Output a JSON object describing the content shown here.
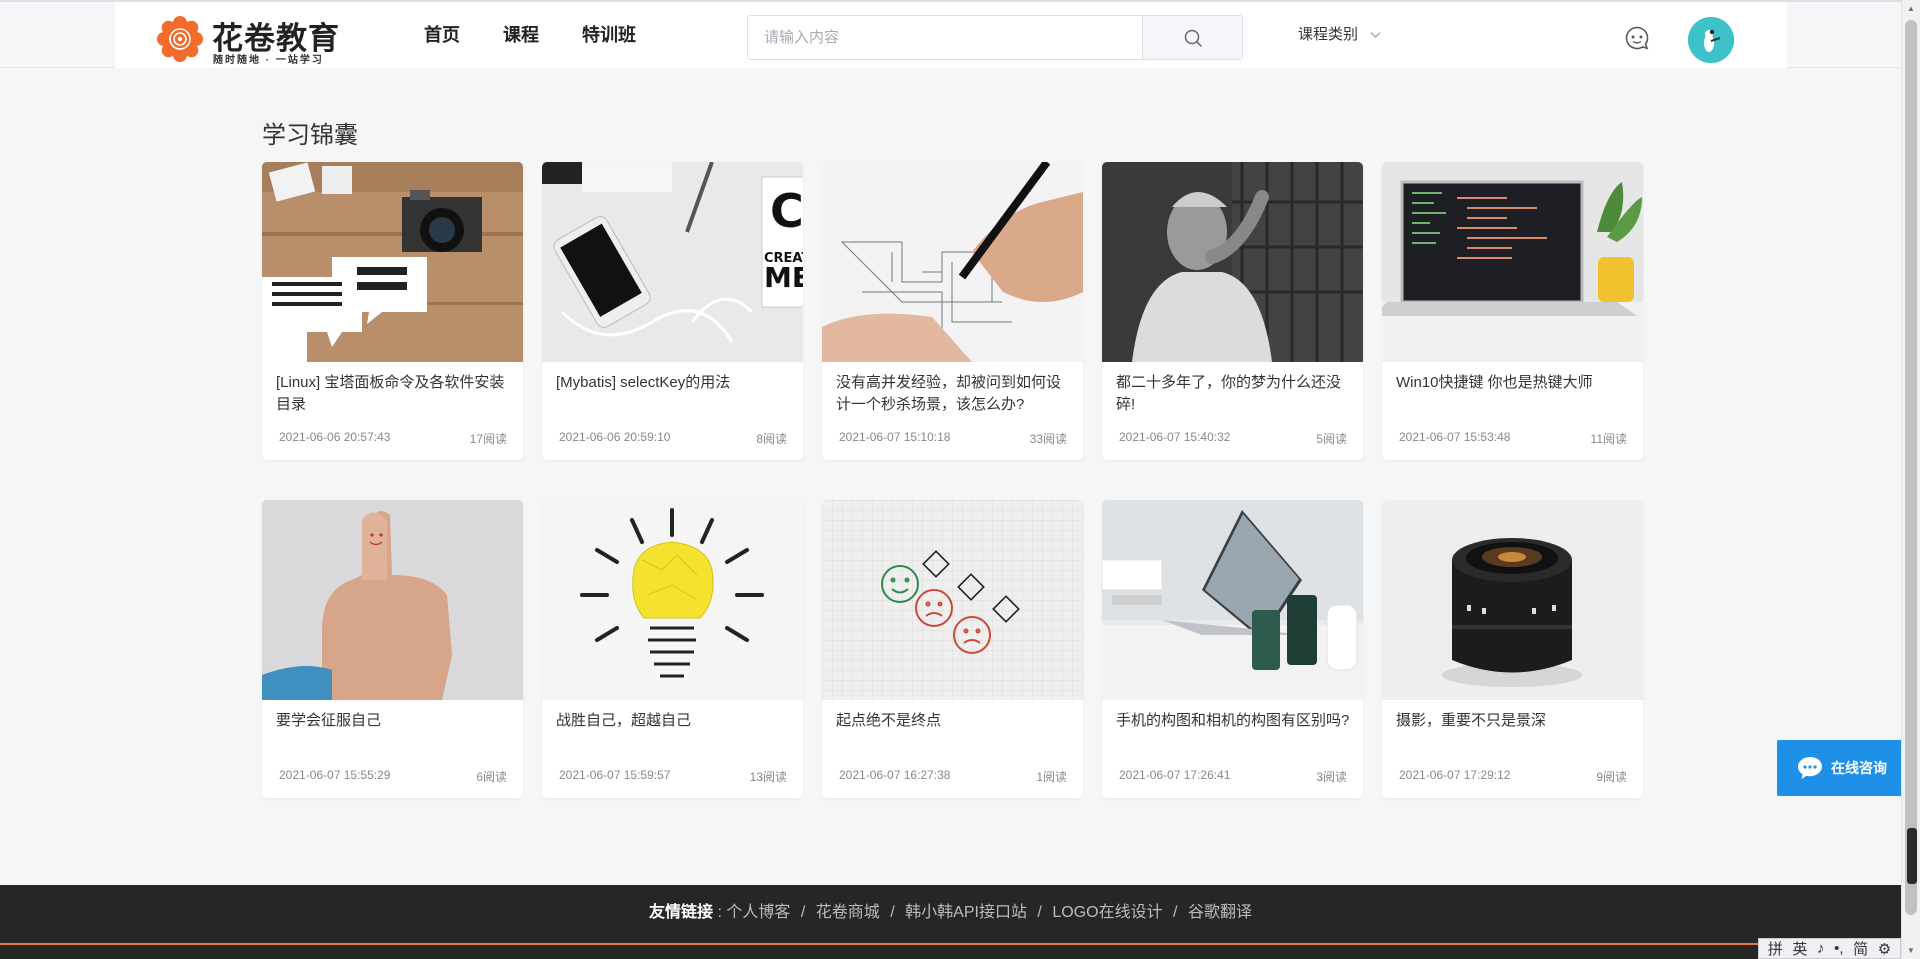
{
  "header": {
    "logo_title": "花卷教育",
    "logo_slogan": "随时随地 · 一站学习",
    "nav": [
      "首页",
      "课程",
      "特训班"
    ],
    "search_placeholder": "请输入内容",
    "category_label": "课程类别"
  },
  "main": {
    "section_title": "学习锦囊",
    "articles": [
      {
        "title": "[Linux] 宝塔面板命令及各软件安装目录",
        "date": "2021-06-06 20:57:43",
        "reads": "17阅读"
      },
      {
        "title": "[Mybatis] selectKey的用法",
        "date": "2021-06-06 20:59:10",
        "reads": "8阅读"
      },
      {
        "title": "没有高并发经验，却被问到如何设计一个秒杀场景，该怎么办?",
        "date": "2021-06-07 15:10:18",
        "reads": "33阅读"
      },
      {
        "title": "都二十多年了，你的梦为什么还没碎!",
        "date": "2021-06-07 15:40:32",
        "reads": "5阅读"
      },
      {
        "title": "Win10快捷键 你也是热键大师",
        "date": "2021-06-07 15:53:48",
        "reads": "11阅读"
      },
      {
        "title": "要学会征服自己",
        "date": "2021-06-07 15:55:29",
        "reads": "6阅读"
      },
      {
        "title": "战胜自己，超越自己",
        "date": "2021-06-07 15:59:57",
        "reads": "13阅读"
      },
      {
        "title": "起点绝不是终点",
        "date": "2021-06-07 16:27:38",
        "reads": "1阅读"
      },
      {
        "title": "手机的构图和相机的构图有区别吗?",
        "date": "2021-06-07 17:26:41",
        "reads": "3阅读"
      },
      {
        "title": "摄影，重要不只是景深",
        "date": "2021-06-07 17:29:12",
        "reads": "9阅读"
      }
    ]
  },
  "footer": {
    "label": "友情链接",
    "colon": ":",
    "links": [
      "个人博客",
      "花卷商城",
      "韩小韩API接口站",
      "LOGO在线设计",
      "谷歌翻译"
    ],
    "separator": "/"
  },
  "widgets": {
    "consult_label": "在线咨询",
    "ime_items": [
      "拼",
      "英",
      "♪",
      "•,",
      "简",
      "⚙"
    ]
  },
  "colors": {
    "brand_orange": "#f26b2b",
    "footer_bg": "#262626",
    "footer_accent": "#e8773a",
    "consult_blue": "#1e90e8",
    "avatar_teal": "#3cc2c8"
  }
}
